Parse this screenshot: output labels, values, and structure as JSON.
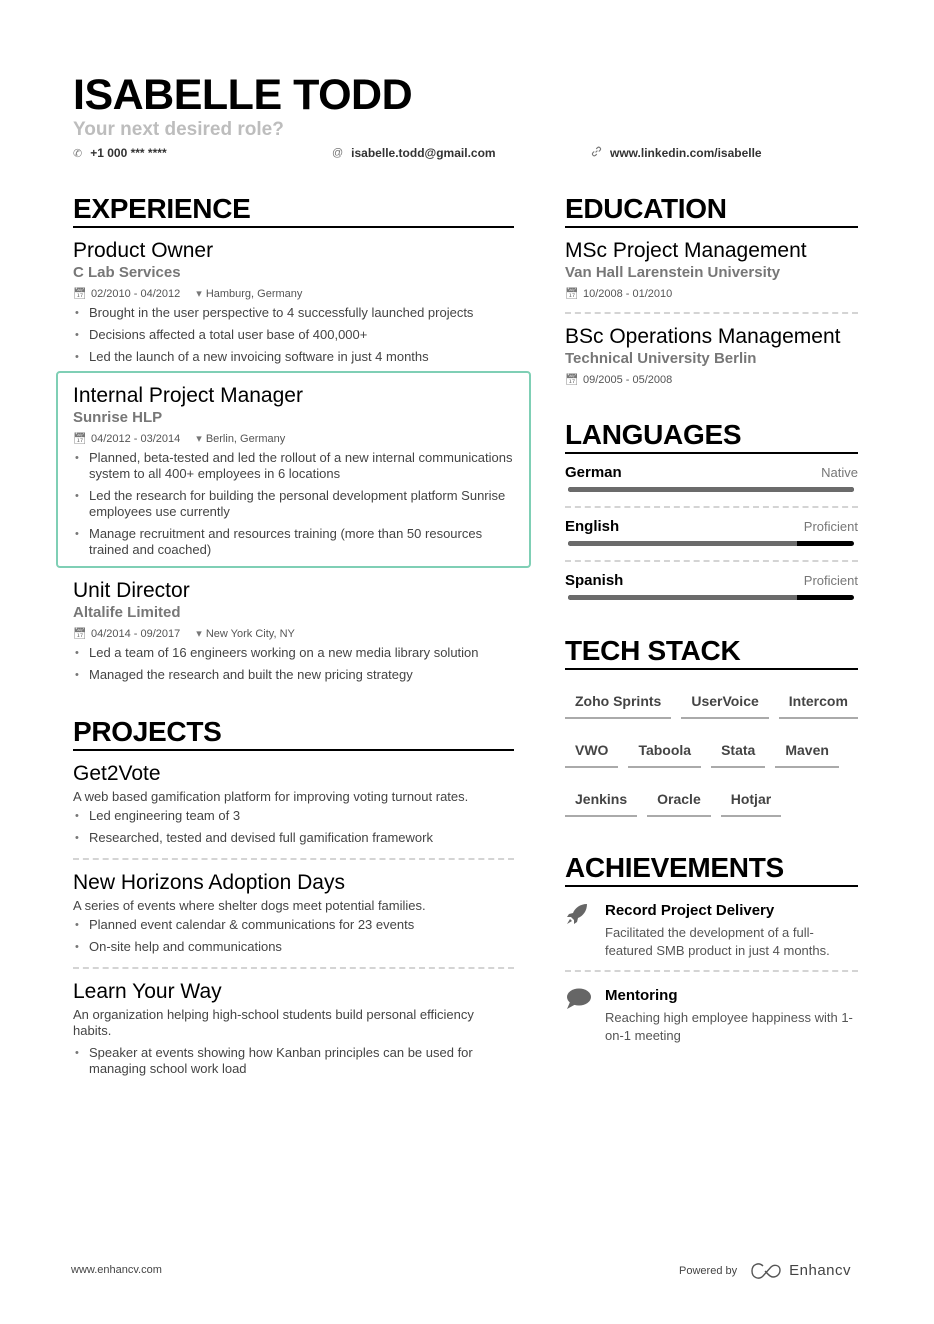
{
  "header": {
    "name": "ISABELLE TODD",
    "role": "Your next desired role?",
    "phone": "+1 000 *** ****",
    "email": "isabelle.todd@gmail.com",
    "linkedin": "www.linkedin.com/isabelle",
    "icons": {
      "phone": "phone-icon",
      "email": "at-icon",
      "link": "link-icon"
    }
  },
  "experience": {
    "title": "EXPERIENCE",
    "items": [
      {
        "role": "Product Owner",
        "company": "C Lab Services",
        "dates": "02/2010 - 04/2012",
        "location": "Hamburg, Germany",
        "bullets": [
          "Brought in the user perspective to 4 successfully launched projects",
          "Decisions affected a total user base of 400,000+",
          "Led the launch of a new invoicing software in just 4 months"
        ]
      },
      {
        "role": "Internal Project Manager",
        "company": "Sunrise HLP",
        "dates": "04/2012 - 03/2014",
        "location": "Berlin, Germany",
        "bullets": [
          "Planned, beta-tested and led the rollout of a new internal communications system to all 400+ employees in 6 locations",
          "Led the research for building the personal development platform Sunrise employees use currently",
          "Manage recruitment and resources training (more than 50 resources trained and coached)"
        ]
      },
      {
        "role": "Unit Director",
        "company": "Altalife Limited",
        "dates": "04/2014 - 09/2017",
        "location": "New York City, NY",
        "bullets": [
          "Led a team of 16 engineers working on a new media library solution",
          "Managed the research and built the new pricing strategy"
        ]
      }
    ]
  },
  "projects": {
    "title": "PROJECTS",
    "items": [
      {
        "name": "Get2Vote",
        "description": "A web based gamification platform for improving voting turnout rates.",
        "bullets": [
          "Led engineering team of 3",
          "Researched, tested and devised full gamification framework"
        ]
      },
      {
        "name": "New Horizons Adoption Days",
        "description": "A series of events where shelter dogs meet potential families.",
        "bullets": [
          "Planned event calendar & communications for 23 events",
          "On-site help and communications"
        ]
      },
      {
        "name": "Learn Your Way",
        "description": "An organization helping high-school students build personal efficiency habits.",
        "bullets": [
          "Speaker at events showing how Kanban principles can be used for managing school work load"
        ]
      }
    ]
  },
  "education": {
    "title": "EDUCATION",
    "items": [
      {
        "degree": "MSc Project Management",
        "school": "Van Hall Larenstein University",
        "dates": "10/2008 - 01/2010"
      },
      {
        "degree": "BSc Operations Management",
        "school": "Technical University Berlin",
        "dates": "09/2005 - 05/2008"
      }
    ]
  },
  "languages": {
    "title": "LANGUAGES",
    "items": [
      {
        "name": "German",
        "level": "Native",
        "proficiency_percent": 100
      },
      {
        "name": "English",
        "level": "Proficient",
        "proficiency_percent": 80
      },
      {
        "name": "Spanish",
        "level": "Proficient",
        "proficiency_percent": 80
      }
    ]
  },
  "tech_stack": {
    "title": "TECH STACK",
    "items": [
      "Zoho Sprints",
      "UserVoice",
      "Intercom",
      "VWO",
      "Taboola",
      "Stata",
      "Maven",
      "Jenkins",
      "Oracle",
      "Hotjar"
    ]
  },
  "achievements": {
    "title": "ACHIEVEMENTS",
    "items": [
      {
        "icon": "rocket-icon",
        "title": "Record Project Delivery",
        "description": "Facilitated the development of a full-featured SMB product in just 4 months."
      },
      {
        "icon": "speech-bubble-icon",
        "title": "Mentoring",
        "description": "Reaching high employee happiness with 1-on-1 meeting"
      }
    ]
  },
  "footer": {
    "website": "www.enhancv.com",
    "powered_by": "Powered by",
    "brand": "Enhancv"
  }
}
